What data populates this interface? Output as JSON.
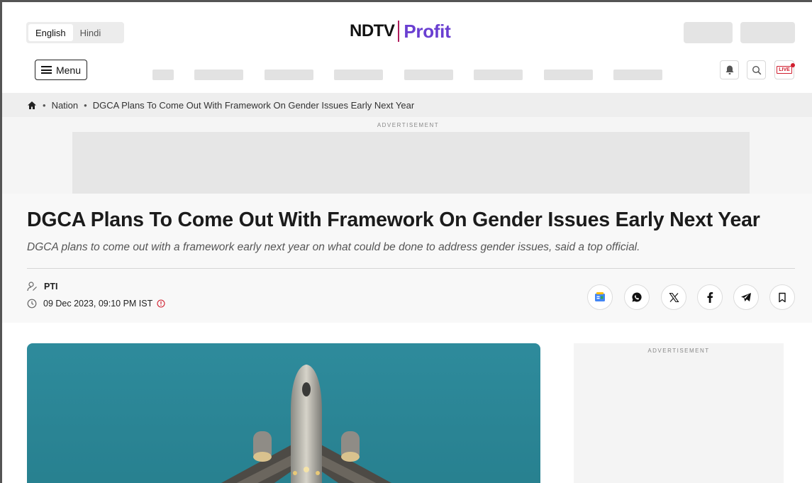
{
  "header": {
    "languages": [
      {
        "label": "English",
        "active": true
      },
      {
        "label": "Hindi",
        "active": false
      }
    ],
    "logo": {
      "part1": "NDTV",
      "part2": "Profit"
    },
    "menu_label": "Menu",
    "live_label": "LIVE"
  },
  "breadcrumb": {
    "home_icon": "home-icon",
    "items": [
      "Nation",
      "DGCA Plans To Come Out With Framework On Gender Issues Early Next Year"
    ]
  },
  "ads": {
    "top_label": "ADVERTISEMENT",
    "side_label": "ADVERTISEMENT"
  },
  "article": {
    "title": "DGCA Plans To Come Out With Framework On Gender Issues Early Next Year",
    "subtitle": "DGCA plans to come out with a framework early next year on what could be done to address gender issues, said a top official.",
    "author": "PTI",
    "datetime": "09 Dec 2023, 09:10 PM IST"
  },
  "share_icons": [
    "google-news-icon",
    "whatsapp-icon",
    "x-icon",
    "facebook-icon",
    "telegram-icon",
    "bookmark-icon"
  ],
  "colors": {
    "brand_purple": "#6a3fd1",
    "live_red": "#d01f2f",
    "hero_sky": "#2e8b9c"
  }
}
